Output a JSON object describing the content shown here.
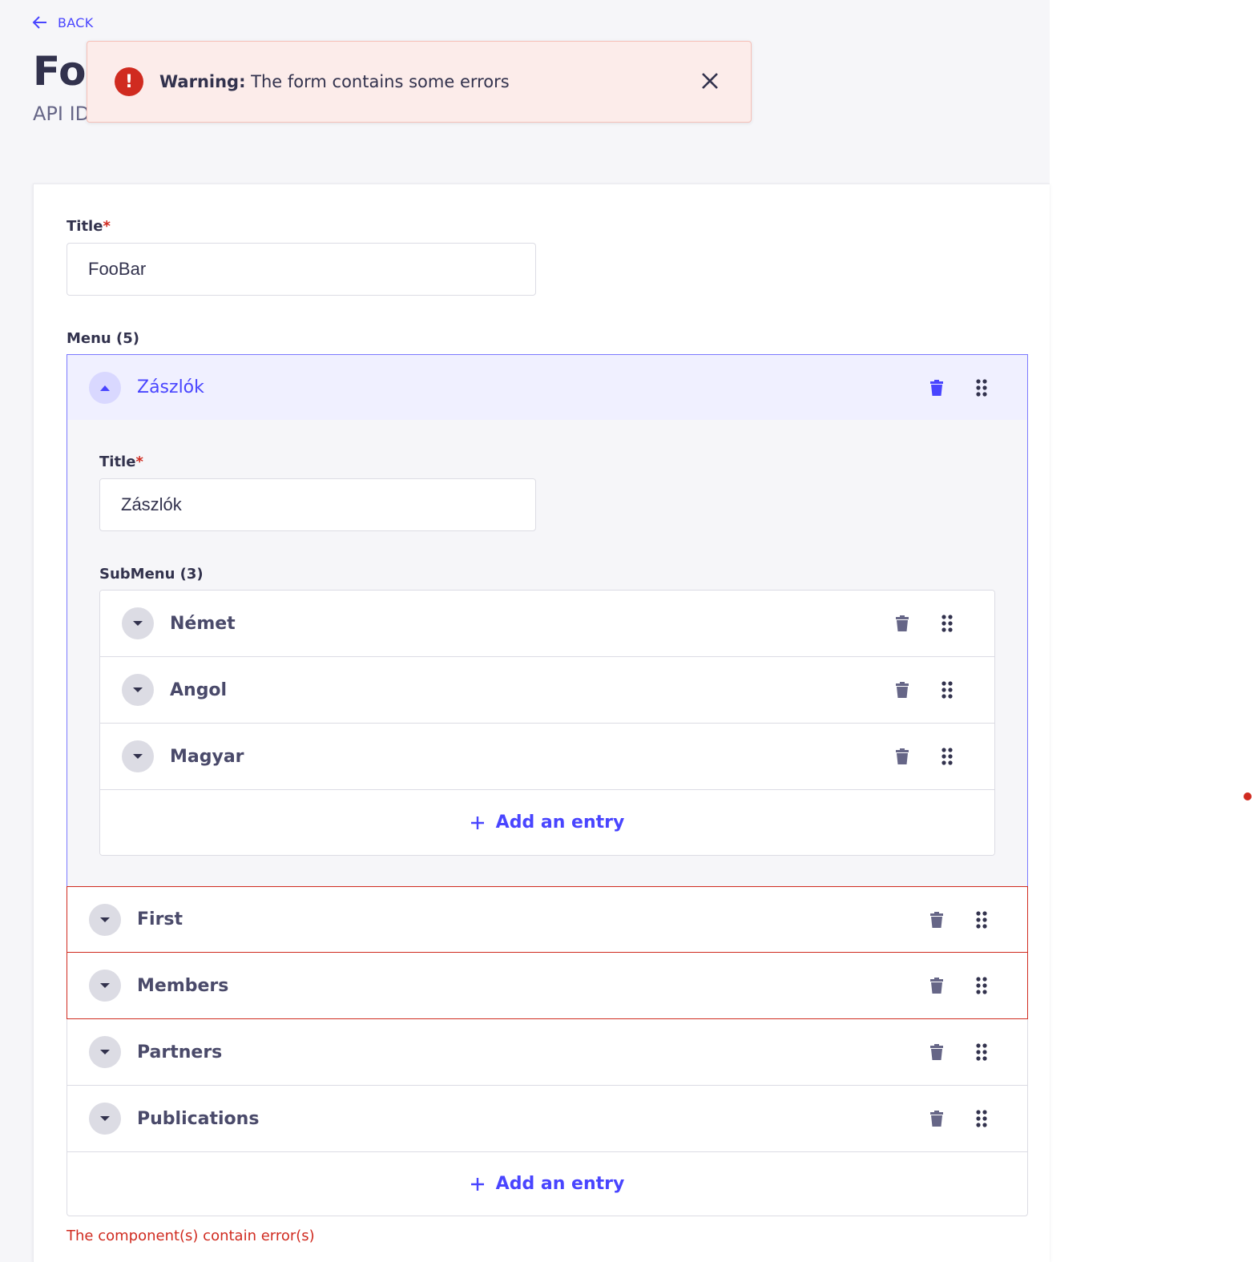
{
  "header": {
    "back_label": "BACK",
    "title": "FooBar",
    "subtitle": "API ID"
  },
  "alert": {
    "title": "Warning:",
    "message": "The form contains some errors"
  },
  "form": {
    "title_label": "Title",
    "title_value": "FooBar",
    "menu_label": "Menu (5)",
    "menu_items": [
      {
        "label": "Zászlók",
        "expanded": true,
        "title_label": "Title",
        "title_value": "Zászlók",
        "submenu_label": "SubMenu (3)",
        "submenu_items": [
          "Német",
          "Angol",
          "Magyar"
        ],
        "add_entry_label": "Add an entry"
      },
      {
        "label": "First",
        "error": true
      },
      {
        "label": "Members",
        "error": true
      },
      {
        "label": "Partners",
        "error": false
      },
      {
        "label": "Publications",
        "error": false
      }
    ],
    "add_entry_label": "Add an entry",
    "error_message": "The component(s) contain error(s)"
  },
  "colors": {
    "primary": "#4945ff",
    "danger": "#d02b20",
    "alert_bg": "#fcecea",
    "page_bg": "#f6f6f9",
    "expanded_header_bg": "#f0f0ff"
  },
  "icons": {
    "back": "arrow-left-icon",
    "alert": "exclamation-circle-icon",
    "close": "close-icon",
    "chevron_up": "chevron-up-icon",
    "chevron_down": "chevron-down-icon",
    "trash": "trash-icon",
    "drag": "drag-handle-icon",
    "plus": "plus-icon"
  }
}
